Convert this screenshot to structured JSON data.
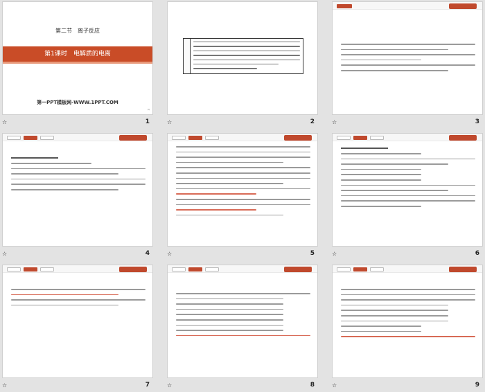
{
  "slide1": {
    "section": "第二节　离子反应",
    "lesson": "第1课时　电解质的电离",
    "footer": "第一PPT模板网-WWW.1PPT.COM"
  },
  "captions": [
    {
      "star": "☆",
      "num": "1"
    },
    {
      "star": "☆",
      "num": "2"
    },
    {
      "star": "☆",
      "num": "3"
    },
    {
      "star": "☆",
      "num": "4"
    },
    {
      "star": "☆",
      "num": "5"
    },
    {
      "star": "☆",
      "num": "6"
    },
    {
      "star": "☆",
      "num": "7"
    },
    {
      "star": "☆",
      "num": "8"
    },
    {
      "star": "☆",
      "num": "9"
    }
  ],
  "colors": {
    "accent": "#c94c27",
    "answer": "#d23b2a"
  }
}
